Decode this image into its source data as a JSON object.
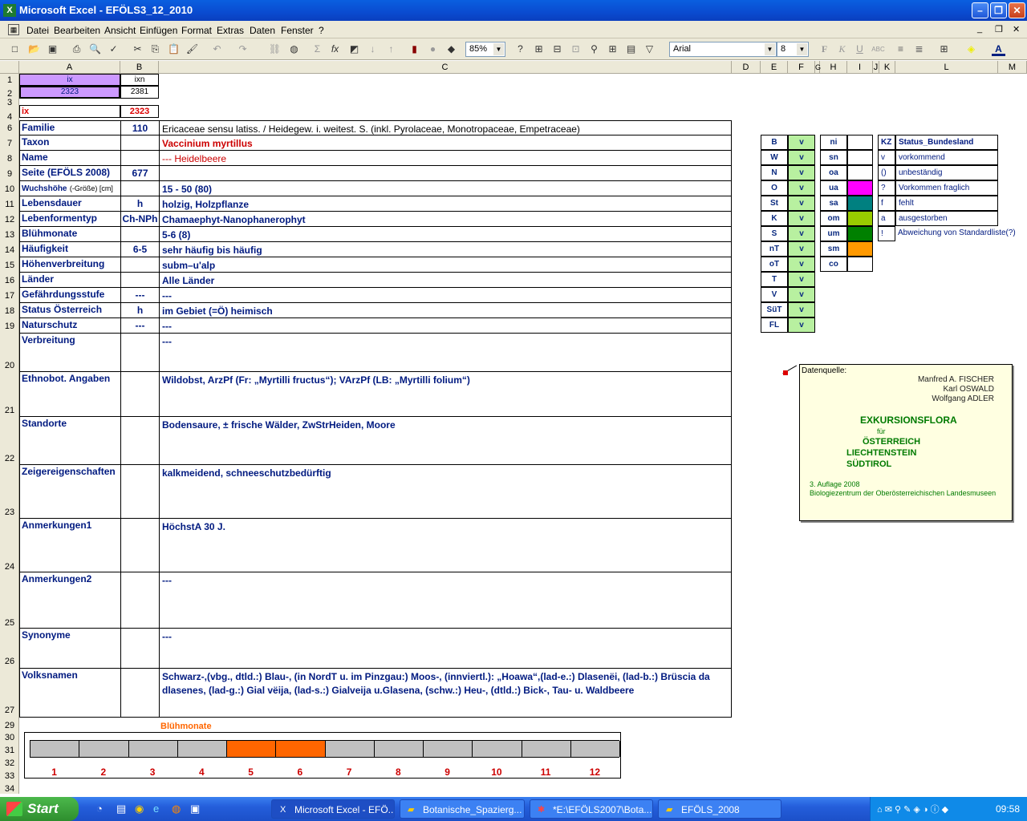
{
  "window": {
    "title": "Microsoft Excel - EFÖLS3_12_2010"
  },
  "menu": [
    "Datei",
    "Bearbeiten",
    "Ansicht",
    "Einfügen",
    "Format",
    "Extras",
    "Daten",
    "Fenster",
    "?"
  ],
  "toolbar": {
    "zoom": "85%",
    "view": "Ansicht",
    "font": "Arial",
    "size": "8"
  },
  "columns": [
    "A",
    "B",
    "C",
    "D",
    "E",
    "F",
    "G",
    "H",
    "I",
    "J",
    "K",
    "L",
    "M"
  ],
  "top": {
    "a1": "ix",
    "b1": "ixn",
    "a2": "2323",
    "b2": "2381",
    "a4": "ix",
    "b4": "2323"
  },
  "rows": [
    {
      "n": "6",
      "label": "Familie",
      "b": "110",
      "c": "Ericaceae sensu latiss.  /  Heidegew. i. weitest. S. (inkl. Pyrolaceae, Monotropaceae, Empetraceae)"
    },
    {
      "n": "7",
      "label": "Taxon",
      "b": "",
      "c": "Vaccinium myrtillus"
    },
    {
      "n": "8",
      "label": "Name",
      "b": "",
      "c": " --- Heidelbeere"
    },
    {
      "n": "9",
      "label": "Seite (EFÖLS 2008)",
      "b": "677",
      "c": ""
    },
    {
      "n": "10",
      "label": "Wuchshöhe",
      "label_suffix": "(-Größe) [cm]",
      "b": "",
      "c": " 15 - 50 (80)"
    },
    {
      "n": "11",
      "label": "Lebensdauer",
      "b": "h",
      "c": "holzig, Holzpflanze"
    },
    {
      "n": "12",
      "label": "Lebenformentyp",
      "b": "Ch-NPh",
      "c": "Chamaephyt-Nanophanerophyt"
    },
    {
      "n": "13",
      "label": "Blühmonate",
      "b": "",
      "c": " 5-6 (8)"
    },
    {
      "n": "14",
      "label": "Häufigkeit",
      "b": "6-5",
      "c": "sehr häufig bis häufig"
    },
    {
      "n": "15",
      "label": "Höhenverbreitung",
      "b": "",
      "c": "subm–u'alp"
    },
    {
      "n": "16",
      "label": "Länder",
      "b": "",
      "c": "Alle Länder"
    },
    {
      "n": "17",
      "label": "Gefährdungsstufe",
      "b": "---",
      "c": "  ---"
    },
    {
      "n": "18",
      "label": "Status Österreich",
      "b": "h",
      "c": "im Gebiet (=Ö) heimisch"
    },
    {
      "n": "19",
      "label": "Naturschutz",
      "b": "---",
      "c": " ---"
    },
    {
      "n": "20",
      "label": "Verbreitung",
      "b": "",
      "c": " ---"
    },
    {
      "n": "21",
      "label": "Ethnobot. Angaben",
      "b": "",
      "c": "Wildobst, ArzPf (Fr: „Myrtilli fructus“); VArzPf (LB: „Myrtilli folium“)"
    },
    {
      "n": "22",
      "label": "Standorte",
      "b": "",
      "c": "Bodensaure, ± frische Wälder, ZwStrHeiden, Moore"
    },
    {
      "n": "23",
      "label": "Zeigereigenschaften",
      "b": "",
      "c": "kalkmeidend, schneeschutzbedürftig"
    },
    {
      "n": "24",
      "label": "Anmerkungen1",
      "b": "",
      "c": "HöchstA 30 J."
    },
    {
      "n": "25",
      "label": "Anmerkungen2",
      "b": "",
      "c": "---"
    },
    {
      "n": "26",
      "label": "Synonyme",
      "b": "",
      "c": "---"
    },
    {
      "n": "27",
      "label": "Volksnamen",
      "b": "",
      "c": "Schwarz-,(vbg., dtld.:) Blau-, (in NordT u. im Pinzgau:) Moos-, (innviertl.): „Hoawa“,(lad-e.:) Dlasenëi, (lad-b.:) Brüscia da dlasenes, (lad-g.:) Gial vëija, (lad-s.:) Gialveija u.Glasena, (schw.:) Heu-, (dtld.:) Bick-, Tau- u. Waldbeere"
    }
  ],
  "regions": [
    "B",
    "W",
    "N",
    "O",
    "St",
    "K",
    "S",
    "nT",
    "oT",
    "T",
    "V",
    "SüT",
    "FL"
  ],
  "region_value": "v",
  "zones": [
    {
      "code": "ni",
      "color": ""
    },
    {
      "code": "sn",
      "color": ""
    },
    {
      "code": "oa",
      "color": ""
    },
    {
      "code": "ua",
      "color": "#ff00ff"
    },
    {
      "code": "sa",
      "color": "#008080"
    },
    {
      "code": "om",
      "color": "#99cc00"
    },
    {
      "code": "um",
      "color": "#008000"
    },
    {
      "code": "sm",
      "color": "#ff9900"
    },
    {
      "code": "co",
      "color": ""
    }
  ],
  "legend": {
    "header_kz": "KZ",
    "header_status": "Status_Bundesland",
    "items": [
      {
        "kz": "v",
        "text": "vorkommend"
      },
      {
        "kz": "()",
        "text": "unbeständig"
      },
      {
        "kz": "?",
        "text": "Vorkommen fraglich"
      },
      {
        "kz": "f",
        "text": "fehlt"
      },
      {
        "kz": "a",
        "text": "ausgestorben"
      },
      {
        "kz": "!",
        "text": "Abweichung von Standardliste(?)"
      }
    ]
  },
  "comment": {
    "label": "Datenquelle:",
    "authors": [
      "Manfred A. FISCHER",
      "Karl OSWALD",
      "Wolfgang ADLER"
    ],
    "title": "EXKURSIONSFLORA",
    "fuer": "für",
    "countries": [
      "ÖSTERREICH",
      "LIECHTENSTEIN",
      "SÜDTIROL"
    ],
    "edition": "3. Auflage 2008",
    "publisher": "Biologiezentrum der Oberösterreichischen Landesmuseen"
  },
  "bloom": {
    "title": "Blühmonate",
    "months": [
      "1",
      "2",
      "3",
      "4",
      "5",
      "6",
      "7",
      "8",
      "9",
      "10",
      "11",
      "12"
    ],
    "active": [
      false,
      false,
      false,
      false,
      true,
      true,
      false,
      false,
      false,
      false,
      false,
      false
    ],
    "active_color": "#ff6600",
    "inactive_color": "#c0c0c0"
  },
  "taskbar": {
    "start": "Start",
    "tasks": [
      "Microsoft Excel - EFÖ...",
      "Botanische_Spazierg...",
      "*E:\\EFÖLS2007\\Bota...",
      "EFÖLS_2008"
    ],
    "clock": "09:58"
  }
}
